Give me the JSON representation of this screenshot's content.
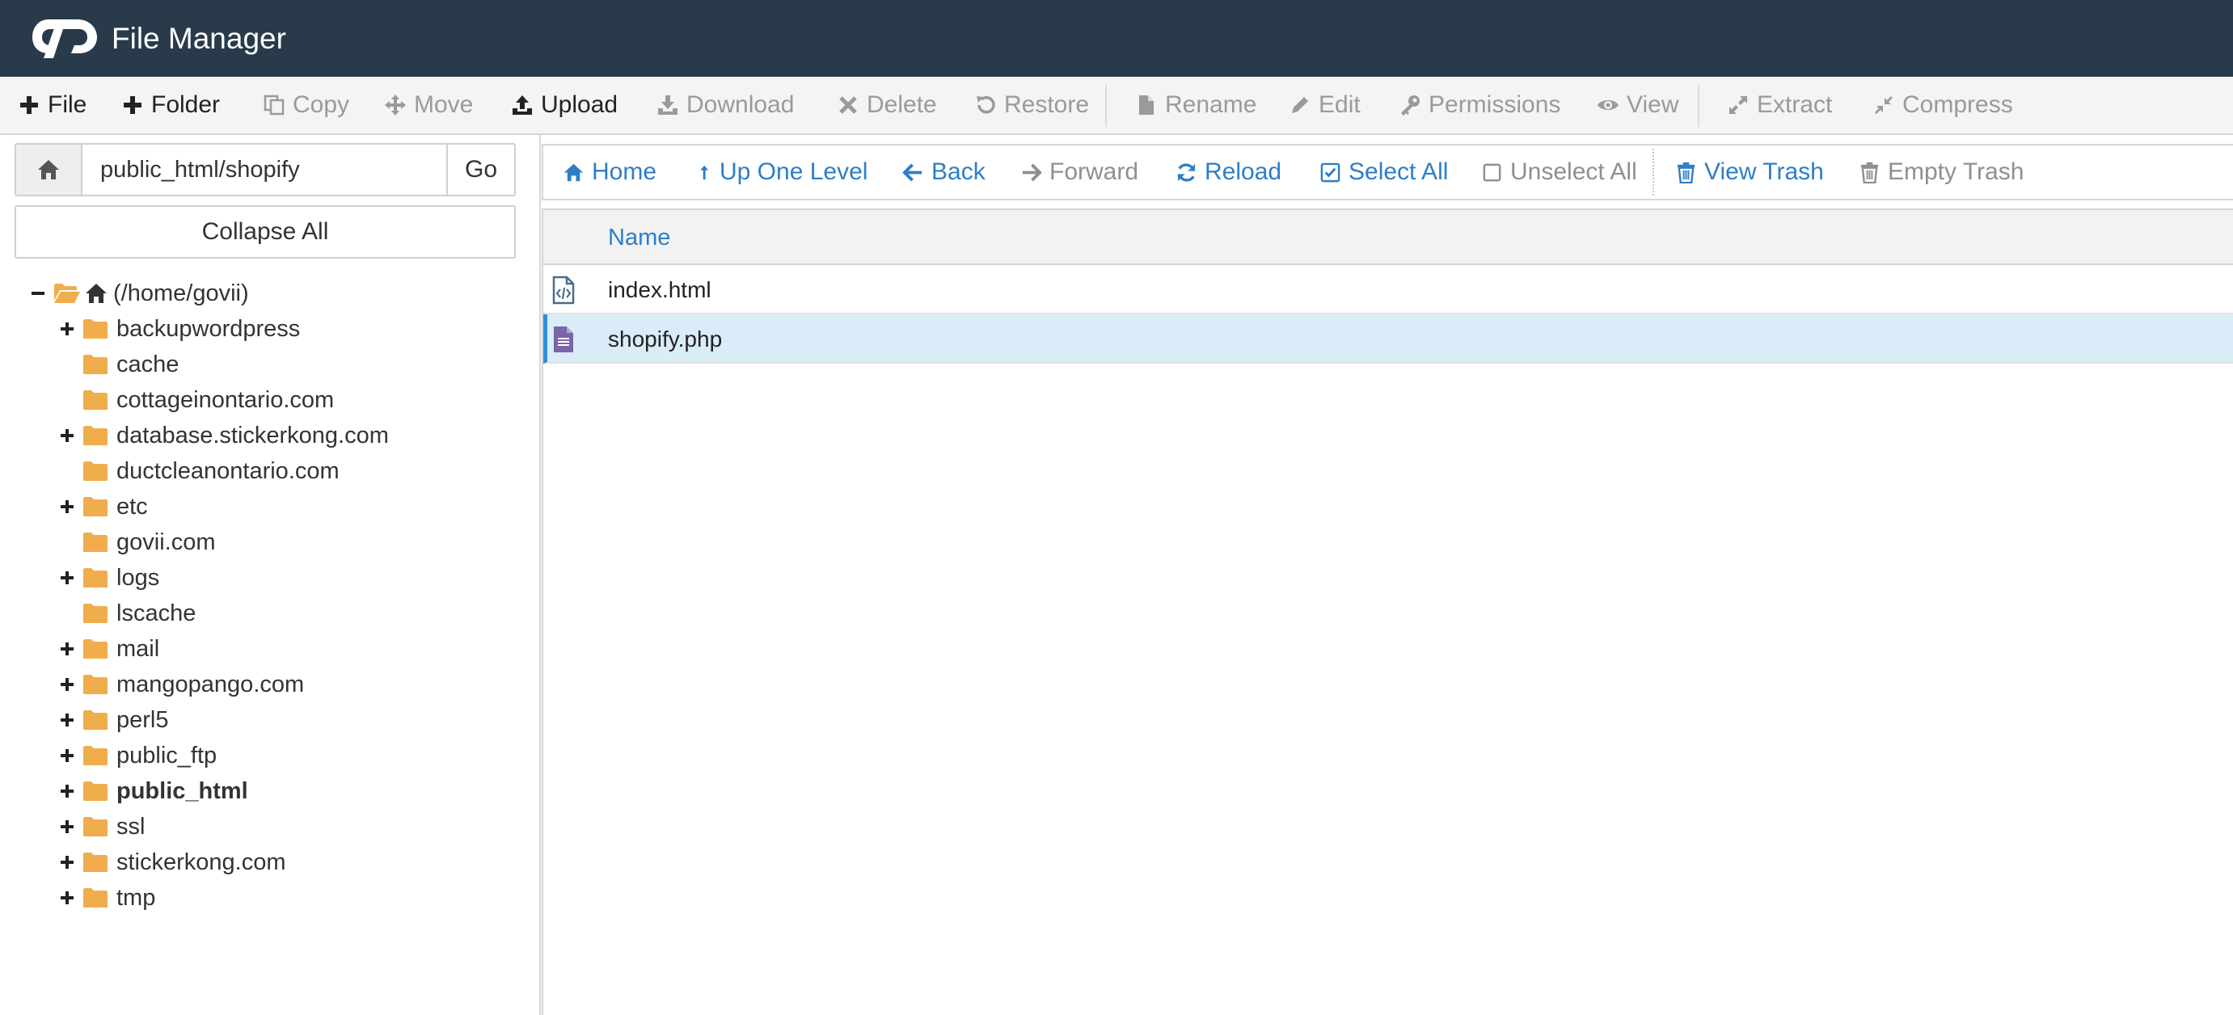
{
  "header": {
    "title": "File Manager"
  },
  "toolbar": {
    "items": [
      {
        "label": "File",
        "enabled": true
      },
      {
        "label": "Folder",
        "enabled": true
      },
      {
        "label": "Copy",
        "enabled": false
      },
      {
        "label": "Move",
        "enabled": false
      },
      {
        "label": "Upload",
        "enabled": true
      },
      {
        "label": "Download",
        "enabled": false
      },
      {
        "label": "Delete",
        "enabled": false
      },
      {
        "label": "Restore",
        "enabled": false
      },
      {
        "label": "Rename",
        "enabled": false
      },
      {
        "label": "Edit",
        "enabled": false
      },
      {
        "label": "Permissions",
        "enabled": false
      },
      {
        "label": "View",
        "enabled": false
      },
      {
        "label": "Extract",
        "enabled": false
      },
      {
        "label": "Compress",
        "enabled": false
      }
    ]
  },
  "path_bar": {
    "value": "public_html/shopify",
    "go_label": "Go"
  },
  "collapse_all_label": "Collapse All",
  "tree": {
    "root": "(/home/govii)",
    "items": [
      {
        "label": "backupwordpress",
        "expandable": true
      },
      {
        "label": "cache",
        "expandable": false
      },
      {
        "label": "cottageinontario.com",
        "expandable": false
      },
      {
        "label": "database.stickerkong.com",
        "expandable": true
      },
      {
        "label": "ductcleanontario.com",
        "expandable": false
      },
      {
        "label": "etc",
        "expandable": true
      },
      {
        "label": "govii.com",
        "expandable": false
      },
      {
        "label": "logs",
        "expandable": true
      },
      {
        "label": "lscache",
        "expandable": false
      },
      {
        "label": "mail",
        "expandable": true
      },
      {
        "label": "mangopango.com",
        "expandable": true
      },
      {
        "label": "perl5",
        "expandable": true
      },
      {
        "label": "public_ftp",
        "expandable": true
      },
      {
        "label": "public_html",
        "expandable": true,
        "current": true
      },
      {
        "label": "ssl",
        "expandable": true
      },
      {
        "label": "stickerkong.com",
        "expandable": true
      },
      {
        "label": "tmp",
        "expandable": true
      }
    ]
  },
  "nav": {
    "items": [
      {
        "label": "Home",
        "enabled": true
      },
      {
        "label": "Up One Level",
        "enabled": true
      },
      {
        "label": "Back",
        "enabled": true
      },
      {
        "label": "Forward",
        "enabled": false
      },
      {
        "label": "Reload",
        "enabled": true
      },
      {
        "label": "Select All",
        "enabled": true
      },
      {
        "label": "Unselect All",
        "enabled": false
      },
      {
        "label": "View Trash",
        "enabled": true
      },
      {
        "label": "Empty Trash",
        "enabled": false
      }
    ]
  },
  "file_table": {
    "columns": [
      "Name"
    ],
    "rows": [
      {
        "name": "index.html",
        "icon": "html-file-icon",
        "selected": false
      },
      {
        "name": "shopify.php",
        "icon": "text-file-icon",
        "selected": true
      }
    ]
  },
  "colors": {
    "header_bg": "#293a4a",
    "link_blue": "#2d7ec6",
    "folder_yellow": "#f0ad4e",
    "selection_bg": "#d9ecf8",
    "php_icon_purple": "#7b64a8"
  }
}
